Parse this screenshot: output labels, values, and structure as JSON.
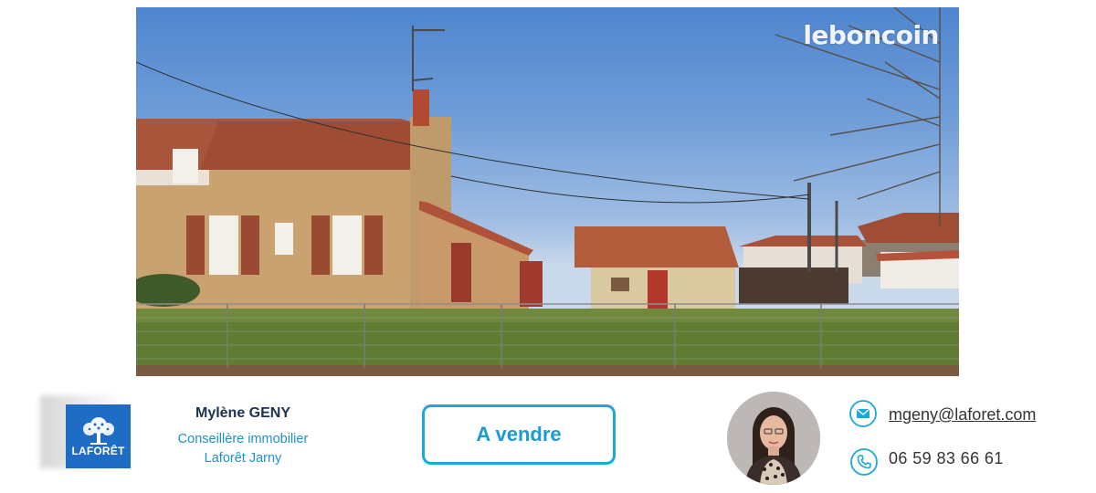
{
  "listing": {
    "photo_alt": "",
    "watermark": "leboncoin"
  },
  "agency": {
    "logo_text": "LAFORÊT"
  },
  "agent": {
    "name": "Mylène GENY",
    "role": "Conseillère immobilier",
    "agency": "Laforêt Jarny"
  },
  "status_button": {
    "label": "A vendre"
  },
  "contact": {
    "email": "mgeny@laforet.com",
    "phone": "06 59 83 66 61",
    "email_icon": "envelope-icon",
    "phone_icon": "phone-icon"
  },
  "colors": {
    "accent": "#1aa9d8",
    "agency_blue": "#1f6cc4",
    "name_text": "#1a3350",
    "role_text": "#1a93c7",
    "contact_text": "#333333"
  }
}
